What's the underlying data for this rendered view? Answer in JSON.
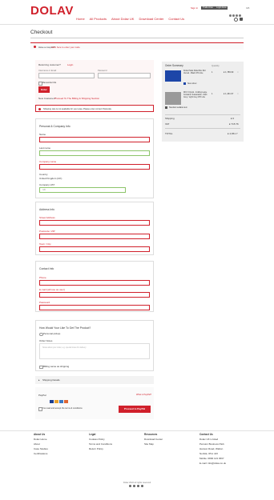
{
  "brand": {
    "logo": "DOLAV",
    "accent": "#d0202b"
  },
  "topbar": {
    "sign_in": "Sign in",
    "btn1": "Trade Area",
    "btn2": "Login Area",
    "tail": "GB"
  },
  "nav": [
    "Home",
    "All Products",
    "About Dolav UK",
    "Download Center",
    "Contact Us"
  ],
  "page_title": "Checkout",
  "coupon": {
    "text": "Have a coupon?",
    "link": "Click here to enter your code"
  },
  "login": {
    "prompt": "Returning customer?",
    "link": "Login",
    "username_label": "Username or Email",
    "password_label": "Password",
    "remember": "Remember Me",
    "button": "Enter",
    "new_text": "New Customer?",
    "new_link": "Proceed To The Billing & Shipping Section"
  },
  "shipping_warning": "Shipping rate is not available for your area. Please enter correct Postcode.",
  "personal": {
    "title": "Personal & Company Info",
    "name_label": "Name",
    "last_name_label": "Last name",
    "company_label": "Company name",
    "country_label": "Country",
    "country_value": "United Kingdom (UK)",
    "vat_label": "Company VAT",
    "vat_placeholder": "GB"
  },
  "address": {
    "title": "Address Info",
    "street_label": "Street Address",
    "postcode_label": "Postcode / ZIP",
    "town_label": "Town / City"
  },
  "contact": {
    "title": "Contact Info",
    "phone_label": "Phone",
    "email_label": "E-mail (will use as user)",
    "password_label": "Password"
  },
  "delivery": {
    "title": "How Would Your Like To Get The Product?",
    "option": "Personal pickup",
    "notes_label": "Order Notes",
    "notes_placeholder": "Notes about your order, e.g. special notes for delivery.",
    "billing_same": "Billing same as shipping"
  },
  "shipping_details": "Shipping Details",
  "payment": {
    "method": "PayPal",
    "what_is": "What is PayPal?",
    "terms": "I've read and accept the terms & conditions",
    "button": "Proceed to PayPal"
  },
  "summary": {
    "title": "Order Summary",
    "qty_header": "Quantity",
    "items": [
      {
        "name": "Dolav Pallet Pallet Box 610 Vented - Black 970 Litre",
        "qty": "1",
        "price": "£ 1,789.99",
        "tag": "New colour"
      },
      {
        "name": "DFC 6 Quick - Folding Large Container Sustainable - Dark Grey / Light Grey 970 Litre",
        "qty": "1",
        "price": "£ 1,461.97",
        "tag": "Standard sellable item"
      }
    ],
    "shipping_label": "Shipping",
    "shipping_value": "£ 0",
    "vat_label": "VAT",
    "vat_value": "£ 715.76",
    "total_label": "TOTAL",
    "total_value": "£ 4,651.7"
  },
  "footer": {
    "cols": [
      {
        "title": "About Us",
        "links": [
          "Dolav Home",
          "About",
          "Case Studies",
          "Certifications"
        ]
      },
      {
        "title": "Legal",
        "links": [
          "Cookies Policy",
          "Terms and Conditions",
          "Return Policy"
        ]
      },
      {
        "title": "Resources",
        "links": [
          "Download Center",
          "Site Map"
        ]
      },
      {
        "title": "Contact Us",
        "links": [
          "Dolav UK Limited",
          "Pension Business Park",
          "Hanson Road, Walton",
          "Norfolk, IP11 4JX",
          "Mobile: 0800 123 4567",
          "E-mail: info@dolav.co.uk"
        ]
      }
    ],
    "copyright": "Dolav 2022 all rights reserved"
  }
}
